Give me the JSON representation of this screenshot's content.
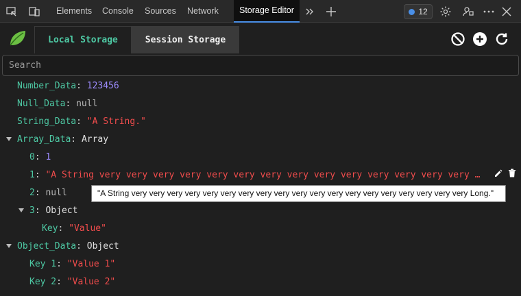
{
  "devtools": {
    "tabs": [
      "Elements",
      "Console",
      "Sources",
      "Network"
    ],
    "active_tab": "Storage Editor",
    "badge_count": "12"
  },
  "extension": {
    "tabs": {
      "local": "Local Storage",
      "session": "Session Storage"
    },
    "search_placeholder": "Search"
  },
  "tree": {
    "number_data": {
      "key": "Number_Data",
      "value": "123456"
    },
    "null_data": {
      "key": "Null_Data",
      "value": "null"
    },
    "string_data": {
      "key": "String_Data",
      "value": "\"A String.\""
    },
    "array_data": {
      "key": "Array_Data",
      "type": "Array",
      "items": [
        {
          "key": "0",
          "value": "1"
        },
        {
          "key": "1",
          "value": "\"A String very very very very very very very very very very very very very very very very very very very Long.\""
        },
        {
          "key": "2",
          "value": "null"
        },
        {
          "key": "3",
          "type": "Object",
          "child_key": "Key",
          "child_value": "\"Value\""
        }
      ]
    },
    "object_data": {
      "key": "Object_Data",
      "type": "Object",
      "items": [
        {
          "key": "Key 1",
          "value": "\"Value 1\""
        },
        {
          "key": "Key 2",
          "value": "\"Value 2\""
        }
      ]
    }
  },
  "tooltip": "\"A String very very very very very very very very very very very very very very very very very very very Long.\"",
  "colors": {
    "key": "#4ec9a4",
    "number": "#9d8cff",
    "string": "#f14c4c",
    "accent": "#4a8fe7"
  }
}
